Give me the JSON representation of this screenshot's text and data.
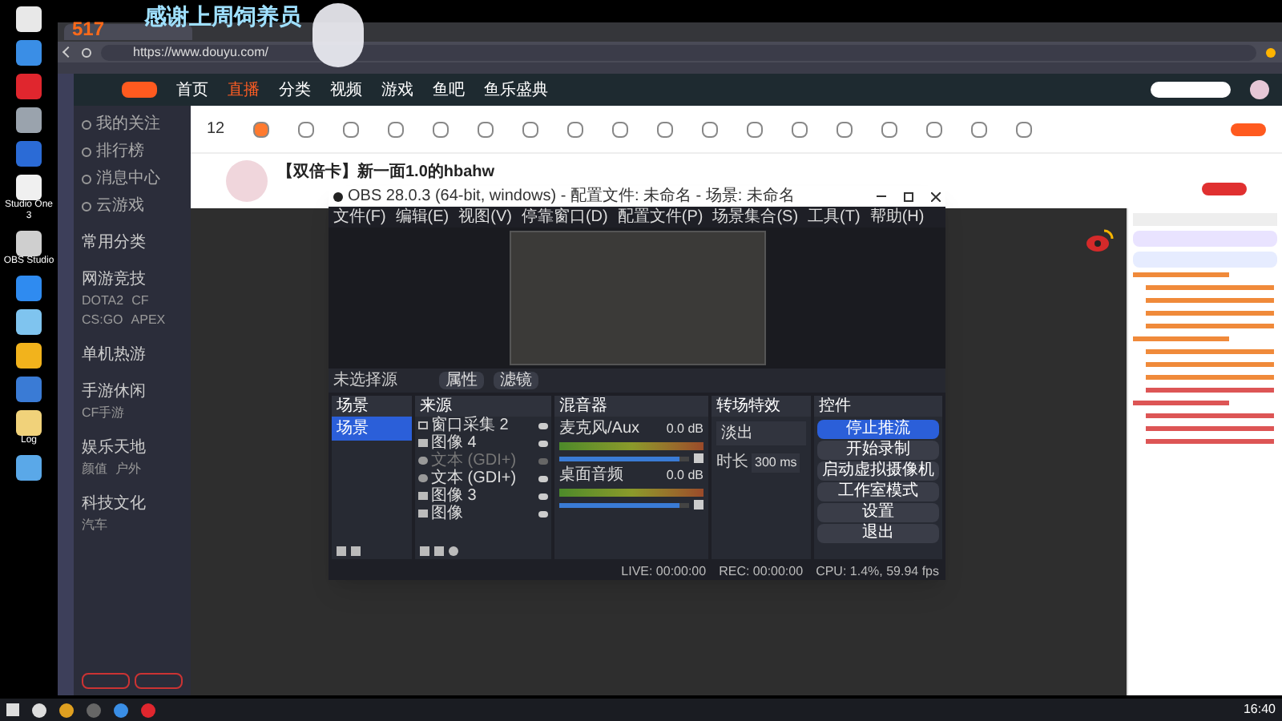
{
  "overlay": {
    "banner": "感谢上周饲养员",
    "count": "517"
  },
  "desktop": {
    "icons": [
      {
        "color": "#e8e8e8"
      },
      {
        "color": "#3a8ee6"
      },
      {
        "color": "#e0262e"
      },
      {
        "color": "#9aa3ad"
      },
      {
        "color": "#2b6bd6"
      },
      {
        "color": "#f0f0f0",
        "label": "Studio One 3"
      },
      {
        "color": "#cfcfcf",
        "label": "OBS Studio"
      },
      {
        "color": "#2f8bf0"
      },
      {
        "color": "#7fc4ef"
      },
      {
        "color": "#f2b31c"
      },
      {
        "color": "#3a7bd5"
      },
      {
        "color": "#f1d27a",
        "label": "Log"
      },
      {
        "color": "#5aa8e8"
      }
    ]
  },
  "browser": {
    "url": "https://www.douyu.com/"
  },
  "site_nav": [
    {
      "label": "首页",
      "selected": false
    },
    {
      "label": "直播",
      "selected": true
    },
    {
      "label": "分类",
      "selected": false
    },
    {
      "label": "视频",
      "selected": false
    },
    {
      "label": "游戏",
      "selected": false
    },
    {
      "label": "鱼吧",
      "selected": false
    },
    {
      "label": "鱼乐盛典",
      "selected": false
    }
  ],
  "side_nav": [
    "我的关注",
    "排行榜",
    "消息中心",
    "云游戏"
  ],
  "categories": [
    {
      "title": "常用分类"
    },
    {
      "title": "网游竞技",
      "items": [
        "DOTA2",
        "CF",
        "CS:GO",
        "APEX"
      ]
    },
    {
      "title": "单机热游"
    },
    {
      "title": "手游休闲",
      "items": [
        "CF手游"
      ]
    },
    {
      "title": "娱乐天地",
      "items": [
        "颜值",
        "户外"
      ]
    },
    {
      "title": "科技文化",
      "items": [
        "汽车"
      ]
    }
  ],
  "toolbar": {
    "count": "12"
  },
  "room": {
    "title": "【双倍卡】新一面1.0的hbahw"
  },
  "obs": {
    "title": "OBS 28.0.3 (64-bit, windows) - 配置文件: 未命名 - 场景: 未命名",
    "menu": [
      "文件(F)",
      "编辑(E)",
      "视图(V)",
      "停靠窗口(D)",
      "配置文件(P)",
      "场景集合(S)",
      "工具(T)",
      "帮助(H)"
    ],
    "source_bar": {
      "label": "未选择源",
      "buttons": [
        "属性",
        "滤镜"
      ]
    },
    "docks": {
      "scenes": "场景",
      "sources": "来源",
      "mixer": "混音器",
      "transitions": "转场特效",
      "controls": "控件"
    },
    "scenes": [
      {
        "name": "场景",
        "selected": true
      }
    ],
    "sources": [
      {
        "name": "窗口采集 2",
        "kind": "window",
        "visible": true
      },
      {
        "name": "图像 4",
        "kind": "image",
        "visible": true
      },
      {
        "name": "文本 (GDI+)",
        "kind": "text",
        "visible": false
      },
      {
        "name": "文本 (GDI+)",
        "kind": "text",
        "visible": true
      },
      {
        "name": "图像 3",
        "kind": "image",
        "visible": true
      },
      {
        "name": "图像",
        "kind": "image",
        "visible": true
      }
    ],
    "mixer": [
      {
        "name": "麦克风/Aux",
        "reading": "0.0 dB",
        "level": 0.92
      },
      {
        "name": "桌面音频",
        "reading": "0.0 dB",
        "level": 0.92
      }
    ],
    "transition": {
      "value": "淡出",
      "duration_label": "时长",
      "duration": "300 ms"
    },
    "controls": [
      {
        "label": "停止推流",
        "active": true
      },
      {
        "label": "开始录制",
        "active": false
      },
      {
        "label": "启动虚拟摄像机",
        "active": false
      },
      {
        "label": "工作室模式",
        "active": false
      },
      {
        "label": "设置",
        "active": false
      },
      {
        "label": "退出",
        "active": false
      }
    ],
    "status": {
      "live": "LIVE: 00:00:00",
      "rec": "REC: 00:00:00",
      "cpu": "CPU: 1.4%, 59.94 fps"
    }
  },
  "taskbar": {
    "time": "16:40"
  }
}
